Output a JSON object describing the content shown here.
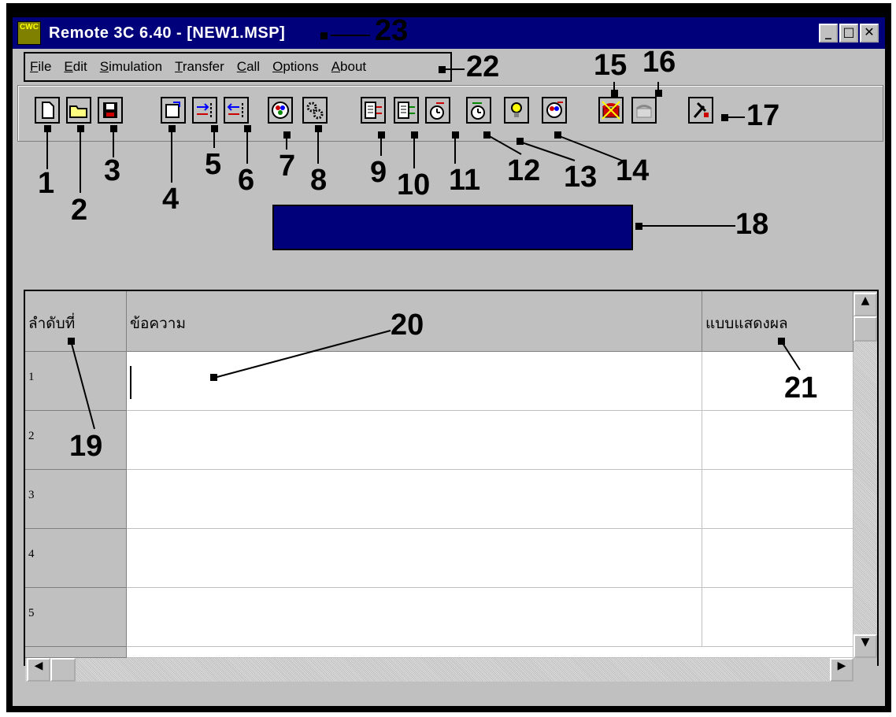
{
  "window": {
    "title": "Remote 3C 6.40 - [NEW1.MSP]",
    "icon_label": "CWC",
    "minimize": "_",
    "maximize": "□",
    "close": "✕"
  },
  "menu": [
    {
      "label": "File",
      "accel": "F"
    },
    {
      "label": "Edit",
      "accel": "E"
    },
    {
      "label": "Simulation",
      "accel": "S"
    },
    {
      "label": "Transfer",
      "accel": "T"
    },
    {
      "label": "Call",
      "accel": "C"
    },
    {
      "label": "Options",
      "accel": "O"
    },
    {
      "label": "About",
      "accel": "A"
    }
  ],
  "toolbar": [
    {
      "name": "new-file-icon"
    },
    {
      "name": "open-folder-icon"
    },
    {
      "name": "save-disk-icon"
    },
    {
      "name": "properties-icon"
    },
    {
      "name": "send-right-icon"
    },
    {
      "name": "send-left-icon"
    },
    {
      "name": "display-icon"
    },
    {
      "name": "settings-gear-icon"
    },
    {
      "name": "upload-document-icon"
    },
    {
      "name": "download-document-icon"
    },
    {
      "name": "clock-send-icon"
    },
    {
      "name": "clock-receive-icon"
    },
    {
      "name": "lightbulb-icon"
    },
    {
      "name": "display-refresh-icon"
    },
    {
      "name": "phone-dial-icon"
    },
    {
      "name": "phone-hangup-icon"
    },
    {
      "name": "tools-icon"
    }
  ],
  "callouts": [
    "1",
    "2",
    "3",
    "4",
    "5",
    "6",
    "7",
    "8",
    "9",
    "10",
    "11",
    "12",
    "13",
    "14",
    "15",
    "16",
    "17",
    "18",
    "19",
    "20",
    "21",
    "22",
    "23"
  ],
  "table": {
    "headers": [
      "ลำดับที่",
      "ข้อความ",
      "แบบแสดงผล"
    ],
    "rows": [
      "1",
      "2",
      "3",
      "4",
      "5"
    ]
  },
  "scroll": {
    "up": "▲",
    "down": "▼",
    "left": "◀",
    "right": "▶"
  }
}
